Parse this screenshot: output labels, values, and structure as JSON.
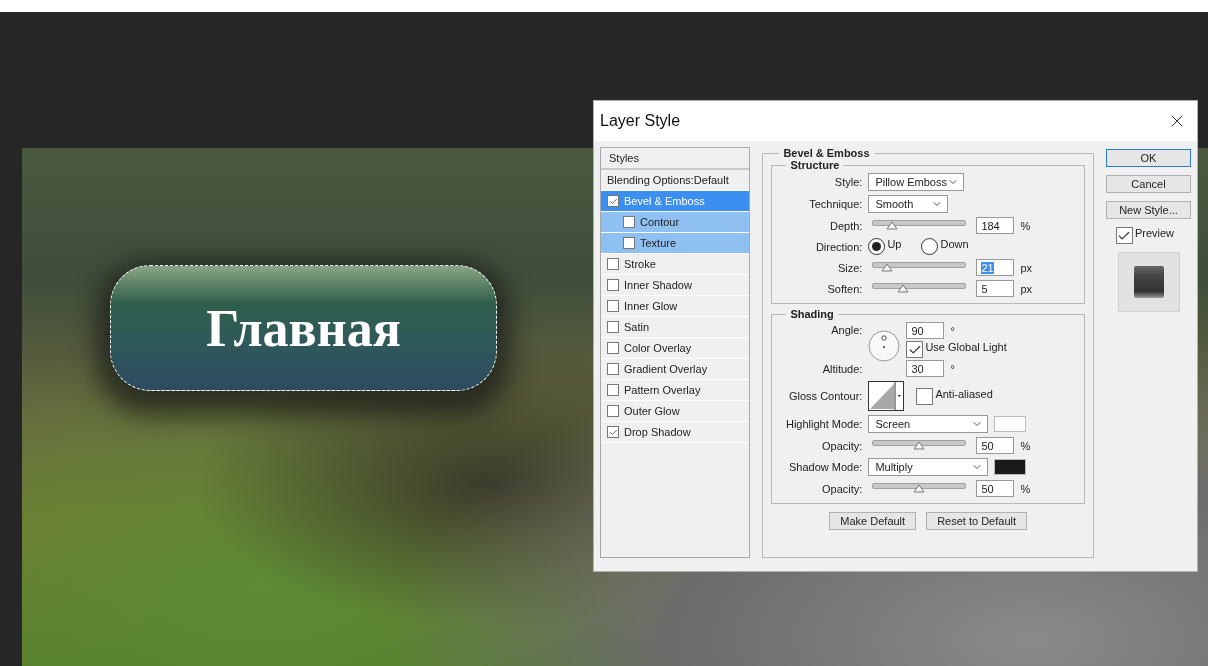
{
  "canvas": {
    "button_text": "Главная"
  },
  "dialog": {
    "title": "Layer Style",
    "styles_panel": {
      "header": "Styles",
      "blending": "Blending Options:Default",
      "items": [
        {
          "label": "Bevel & Emboss",
          "checked": true,
          "selected": true,
          "children": [
            {
              "label": "Contour",
              "checked": false,
              "selected": false
            },
            {
              "label": "Texture",
              "checked": false,
              "selected": false
            }
          ]
        },
        {
          "label": "Stroke",
          "checked": false,
          "selected": false
        },
        {
          "label": "Inner Shadow",
          "checked": false,
          "selected": false
        },
        {
          "label": "Inner Glow",
          "checked": false,
          "selected": false
        },
        {
          "label": "Satin",
          "checked": false,
          "selected": false
        },
        {
          "label": "Color Overlay",
          "checked": false,
          "selected": false
        },
        {
          "label": "Gradient Overlay",
          "checked": false,
          "selected": false
        },
        {
          "label": "Pattern Overlay",
          "checked": false,
          "selected": false
        },
        {
          "label": "Outer Glow",
          "checked": false,
          "selected": false
        },
        {
          "label": "Drop Shadow",
          "checked": true,
          "selected": false
        }
      ]
    },
    "bevel": {
      "title": "Bevel & Emboss",
      "structure": {
        "title": "Structure",
        "style": {
          "label": "Style:",
          "value": "Pillow Emboss"
        },
        "technique": {
          "label": "Technique:",
          "value": "Smooth"
        },
        "depth": {
          "label": "Depth:",
          "level": 0.2,
          "value": "184",
          "unit": "%"
        },
        "direction": {
          "label": "Direction:",
          "options": [
            {
              "label": "Up",
              "selected": true
            },
            {
              "label": "Down",
              "selected": false
            }
          ]
        },
        "size": {
          "label": "Size:",
          "level": 0.15,
          "value": "21",
          "text_selected": true,
          "unit": "px"
        },
        "soften": {
          "label": "Soften:",
          "level": 0.32,
          "value": "5",
          "unit": "px"
        }
      },
      "shading": {
        "title": "Shading",
        "angle": {
          "label": "Angle:",
          "value": "90",
          "unit": "°"
        },
        "use_global_light": {
          "label": "Use Global Light",
          "checked": true
        },
        "altitude": {
          "label": "Altitude:",
          "value": "30",
          "unit": "°"
        },
        "gloss_contour": {
          "label": "Gloss Contour:"
        },
        "anti_aliased": {
          "label": "Anti-aliased",
          "checked": false
        },
        "highlight_mode": {
          "label": "Highlight Mode:",
          "value": "Screen",
          "color": "#ffffff"
        },
        "highlight_opacity": {
          "label": "Opacity:",
          "level": 0.5,
          "value": "50",
          "unit": "%"
        },
        "shadow_mode": {
          "label": "Shadow Mode:",
          "value": "Multiply",
          "color": "#1a1a1a"
        },
        "shadow_opacity": {
          "label": "Opacity:",
          "level": 0.5,
          "value": "50",
          "unit": "%"
        }
      },
      "footer_buttons": [
        "Make Default",
        "Reset to Default"
      ]
    },
    "side_buttons": [
      {
        "label": "OK",
        "kind": "default"
      },
      {
        "label": "Cancel",
        "kind": "normal"
      },
      {
        "label": "New Style...",
        "kind": "normal"
      }
    ],
    "preview": {
      "label": "Preview",
      "checked": true
    }
  }
}
